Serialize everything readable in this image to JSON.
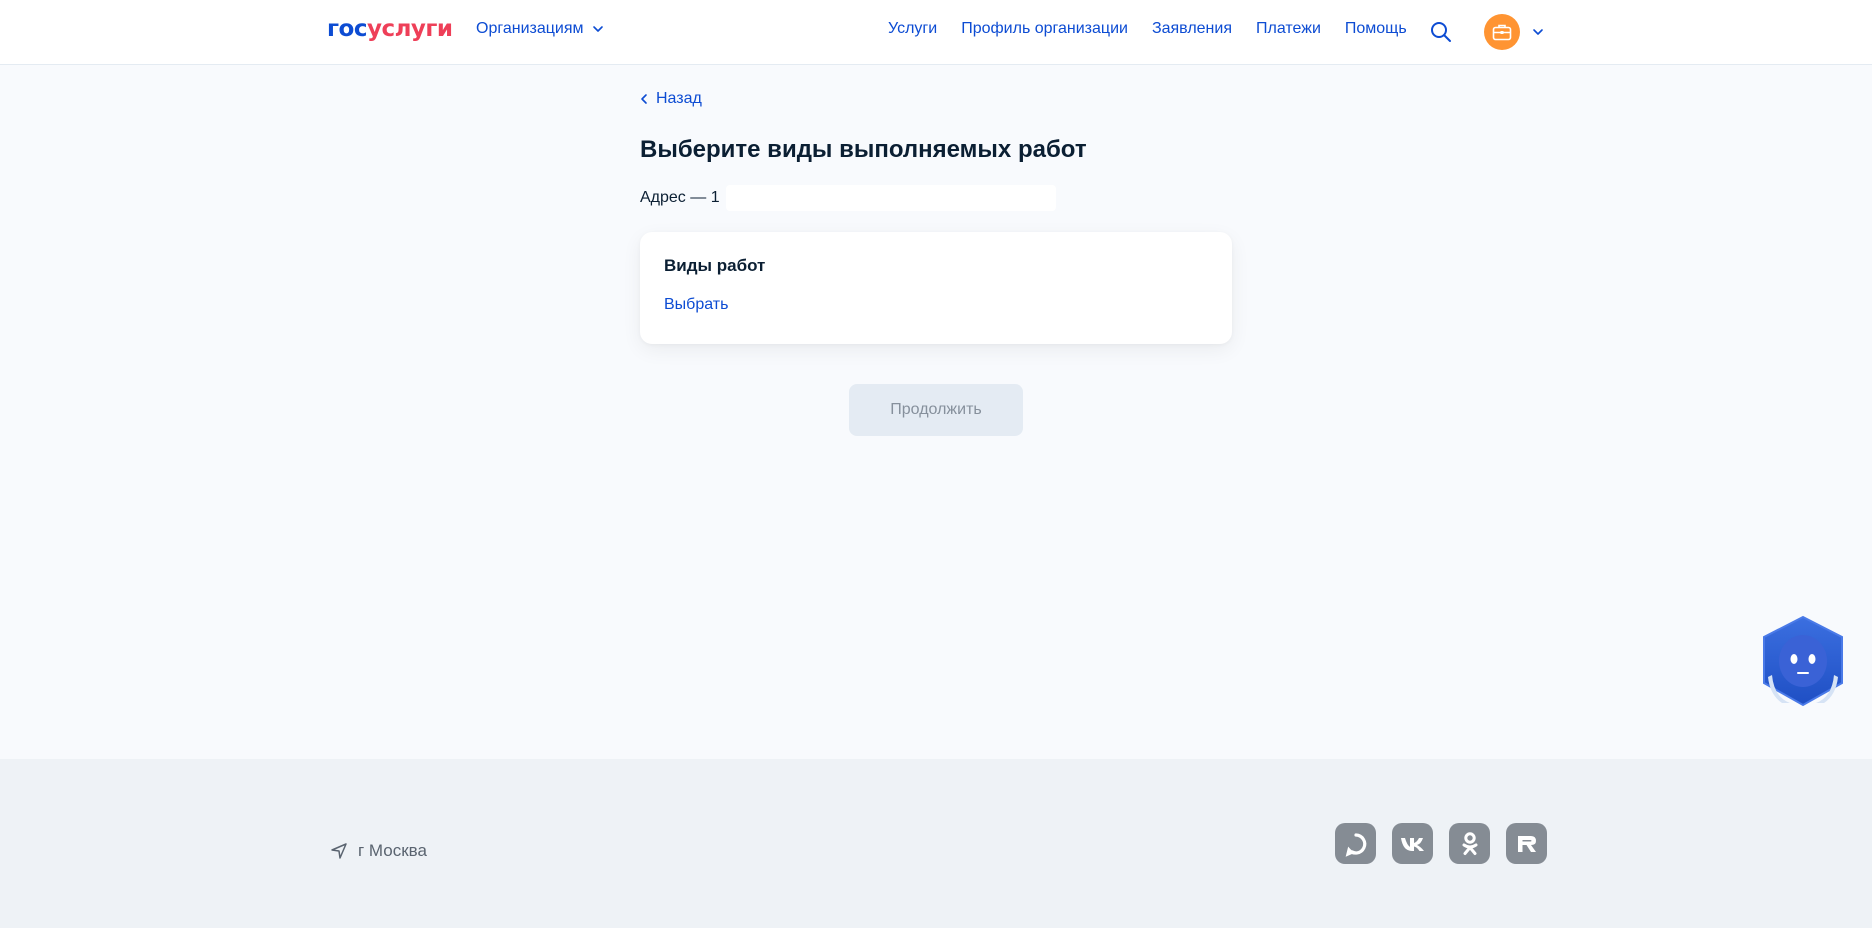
{
  "header": {
    "logo_part1": "гос",
    "logo_part2": "услуги",
    "org_menu_label": "Организациям",
    "nav": [
      "Услуги",
      "Профиль организации",
      "Заявления",
      "Платежи",
      "Помощь"
    ]
  },
  "back_label": "Назад",
  "page_title": "Выберите виды выполняемых работ",
  "address_label": "Адрес — 1",
  "card": {
    "title": "Виды работ",
    "link": "Выбрать"
  },
  "continue_label": "Продолжить",
  "footer": {
    "location": "г Москва",
    "socials": [
      "max-icon",
      "vk-icon",
      "ok-icon",
      "rutube-icon"
    ]
  },
  "colors": {
    "brand_blue": "#0d4cd3",
    "brand_red": "#ee3f58",
    "avatar_orange": "#ff9432",
    "page_bg": "#f8fafd",
    "footer_bg": "#eef2f6"
  }
}
